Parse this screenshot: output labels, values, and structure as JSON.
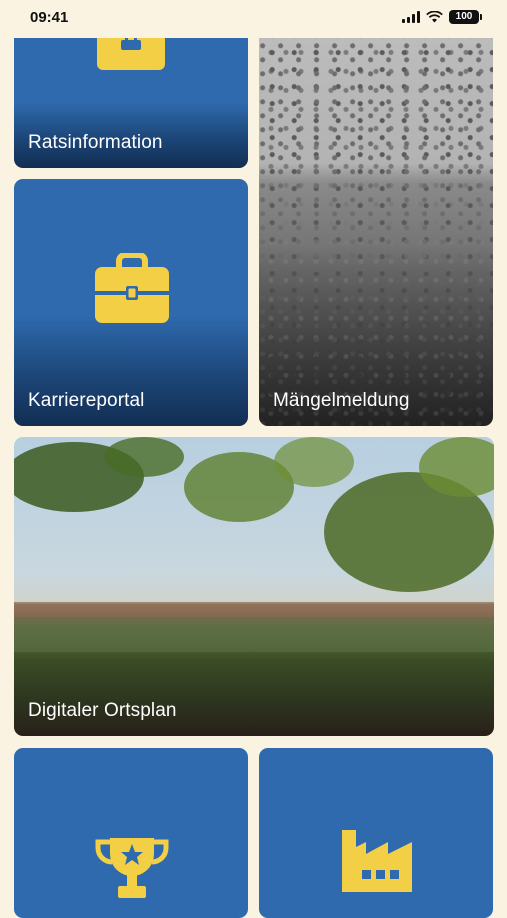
{
  "status_bar": {
    "time": "09:41",
    "battery": "100"
  },
  "tiles": {
    "ratsinformation": {
      "label": "Ratsinformation",
      "icon": "badge-icon"
    },
    "karriereportal": {
      "label": "Karriereportal",
      "icon": "briefcase-icon"
    },
    "maengelmeldung": {
      "label": "Mängelmeldung",
      "image": "gravel-photo"
    },
    "ortsplan": {
      "label": "Digitaler Ortsplan",
      "image": "town-panorama-photo"
    },
    "awards": {
      "label": "",
      "icon": "trophy-icon"
    },
    "business": {
      "label": "",
      "icon": "factory-icon"
    }
  },
  "colors": {
    "background": "#FBF3E2",
    "tile_blue": "#2F6AAE",
    "icon_yellow": "#F3CF45"
  }
}
